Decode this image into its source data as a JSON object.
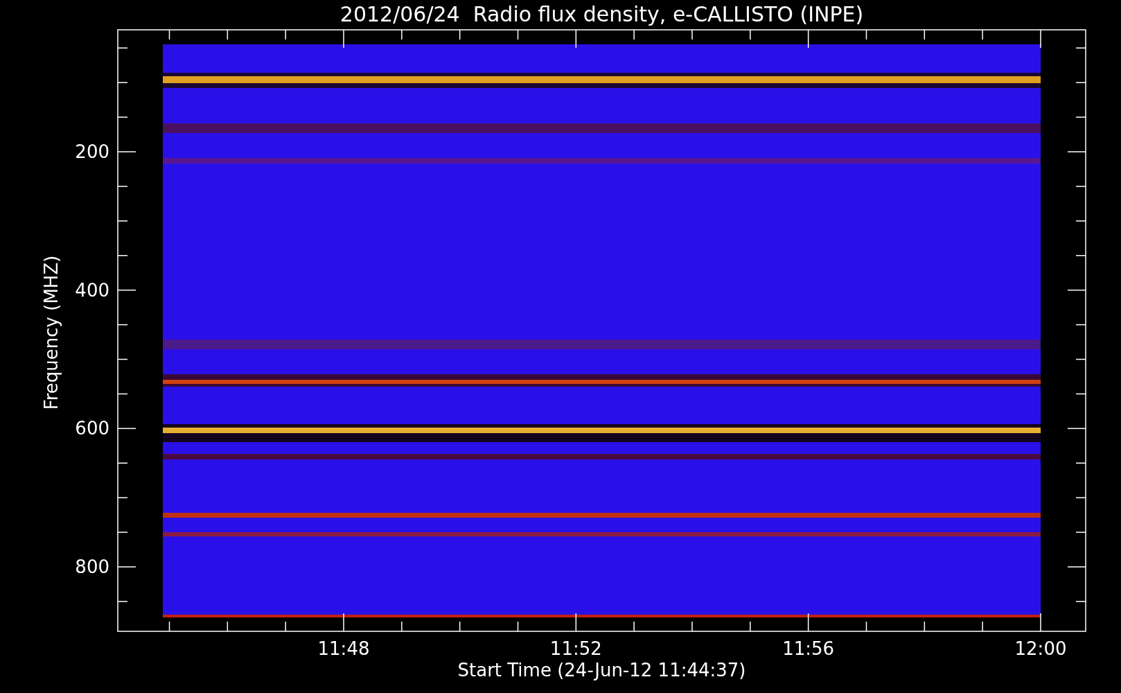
{
  "plot": {
    "title": "2012/06/24  Radio flux density, e-CALLISTO (INPE)",
    "ylabel": "Frequency (MHZ)",
    "xlabel": "Start Time (24-Jun-12 11:44:37)",
    "ytick_labels": [
      "200",
      "400",
      "600",
      "800"
    ],
    "xtick_labels": [
      "11:48",
      "11:52",
      "11:56",
      "12:00"
    ]
  }
}
